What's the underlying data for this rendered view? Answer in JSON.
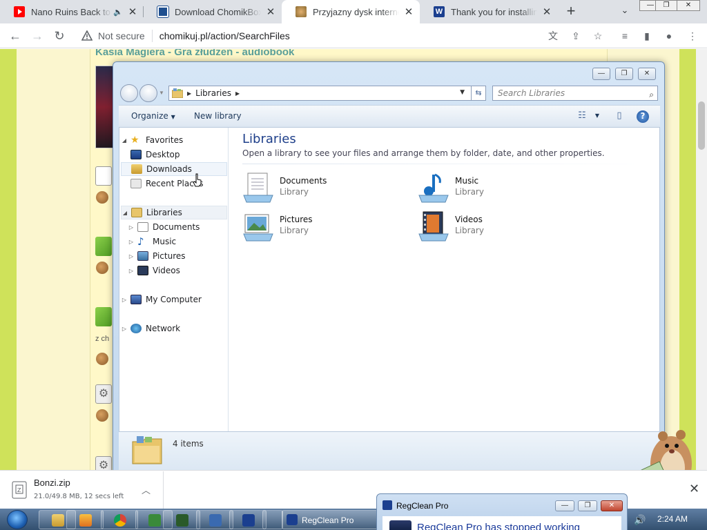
{
  "tabs": [
    {
      "title": "Nano Ruins Back to S",
      "close": "✕",
      "muted": "🔈"
    },
    {
      "title": "Download ChomikBox by",
      "close": "✕"
    },
    {
      "title": "Przyjazny dysk internetow",
      "close": "✕"
    },
    {
      "title": "Thank you for installing R",
      "close": "✕"
    }
  ],
  "window_controls": {
    "minimize": "—",
    "maximize": "❐",
    "close": "✕"
  },
  "toolbar": {
    "back": "←",
    "forward": "→",
    "reload": "↻",
    "not_secure": "Not secure",
    "url": "chomikuj.pl/action/SearchFiles",
    "new_tab": "+",
    "tab_search": "⌄",
    "menu": "⋮"
  },
  "page": {
    "title": "Kasia Magiera - Gra złudzeń - audiobook",
    "snippet": "z ch"
  },
  "explorer": {
    "address": "Libraries",
    "search_placeholder": "Search Libraries",
    "organize": "Organize",
    "new_library": "New library",
    "nav": {
      "favorites": "Favorites",
      "desktop": "Desktop",
      "downloads": "Downloads",
      "recent_places": "Recent Places",
      "libraries": "Libraries",
      "documents": "Documents",
      "music": "Music",
      "pictures": "Pictures",
      "videos": "Videos",
      "my_computer": "My Computer",
      "network": "Network"
    },
    "heading": "Libraries",
    "subheading": "Open a library to see your files and arrange them by folder, date, and other properties.",
    "libraries": [
      {
        "name": "Documents",
        "type": "Library"
      },
      {
        "name": "Music",
        "type": "Library"
      },
      {
        "name": "Pictures",
        "type": "Library"
      },
      {
        "name": "Videos",
        "type": "Library"
      }
    ],
    "status": "4 items"
  },
  "download": {
    "name": "Bonzi.zip",
    "status": "21.0/49.8 MB, 12 secs left"
  },
  "taskbar": {
    "regclean_label": "RegClean Pro",
    "clock": "2:24 AM"
  },
  "regclean": {
    "title": "RegClean Pro",
    "message": "RegClean Pro has stopped working"
  },
  "colors": {
    "page_bg": "#cfe25a",
    "explorer_heading": "#1e3f8a",
    "taskbar": "#33506f"
  }
}
